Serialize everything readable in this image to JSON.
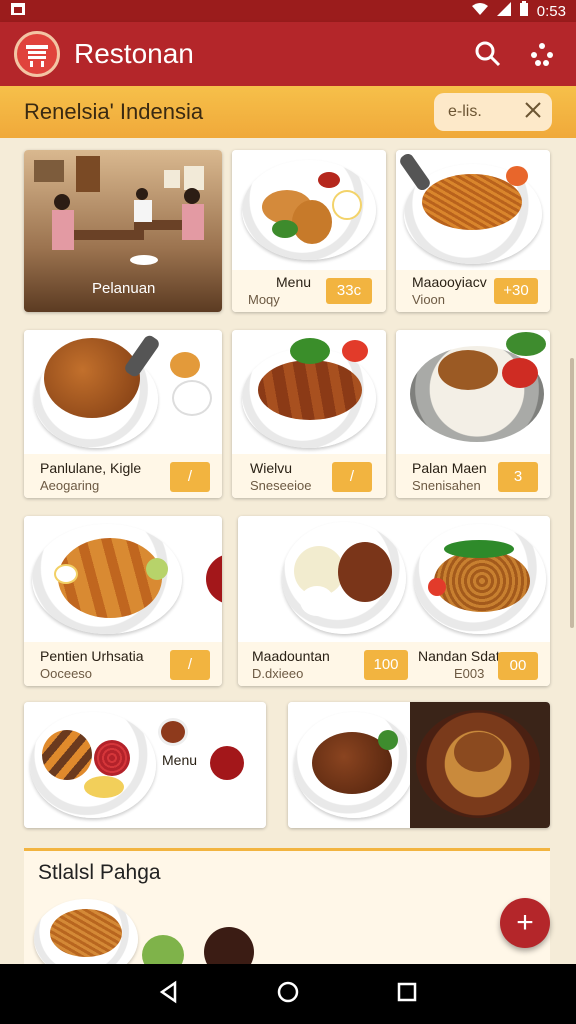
{
  "status": {
    "time": "0:53"
  },
  "appbar": {
    "title": "Restonan",
    "search_icon": "search-icon",
    "menu_icon": "dots-icon"
  },
  "filter": {
    "text": "Renelsia'  Indensia",
    "chip_label": "e-lis."
  },
  "cards": [
    {
      "name": "Pelanuan",
      "sub": "",
      "tag": ""
    },
    {
      "name": "Menu",
      "sub": "Moqy",
      "tag": "33c"
    },
    {
      "name": "Maaooyiacv",
      "sub": "Vioon",
      "tag": "+30"
    },
    {
      "name": "Panlulane, Kigle",
      "sub": "Aeogaring",
      "tag": "/"
    },
    {
      "name": "Wielvu",
      "sub": "Sneseeioe",
      "tag": "/"
    },
    {
      "name": "Palan Maen",
      "sub": "Snenisahen",
      "tag": "3"
    },
    {
      "name": "Pentien Urhsatia",
      "sub": "Ooceeso",
      "tag": "/"
    },
    {
      "name": "Maadountan",
      "sub": "D.dxieeo",
      "tag": "100"
    },
    {
      "name": "Nandan Sdat",
      "sub": "E003",
      "tag": "00"
    },
    {
      "name": "Menu",
      "sub": "",
      "tag": ""
    }
  ],
  "section": {
    "title": "Stlalsl Pahga"
  },
  "fab": {
    "label": "+"
  },
  "colors": {
    "primary": "#b4262a",
    "accent": "#f2b440",
    "background": "#f5ecd8"
  }
}
